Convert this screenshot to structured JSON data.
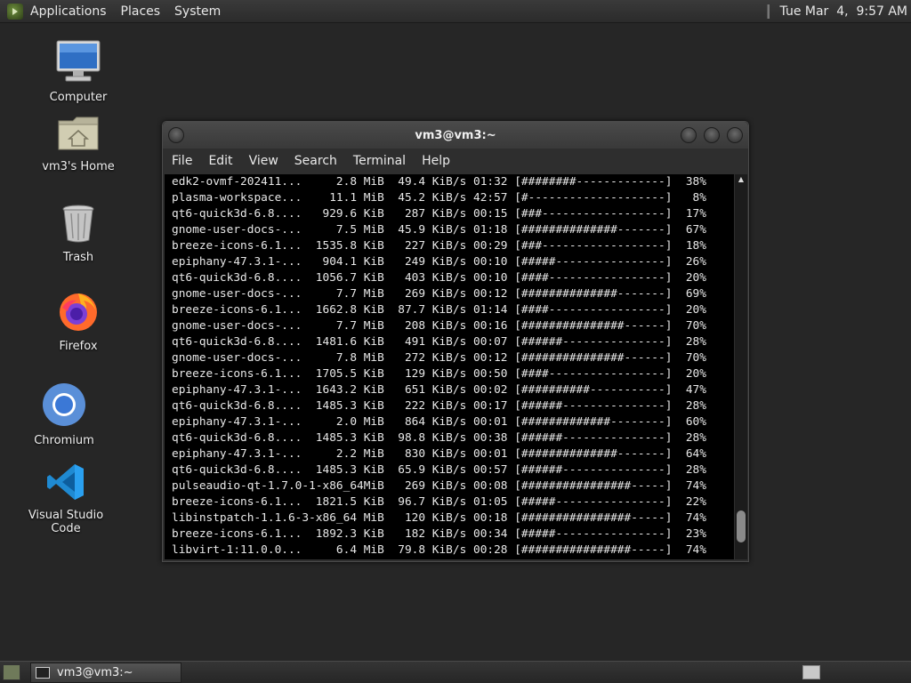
{
  "top_panel": {
    "menus": [
      "Applications",
      "Places",
      "System"
    ],
    "clock": "Tue Mar  4,  9:57 AM"
  },
  "desktop": {
    "icons": [
      {
        "label": "Computer",
        "icon": "computer-icon"
      },
      {
        "label": "vm3's Home",
        "icon": "home-folder-icon"
      },
      {
        "label": "Trash",
        "icon": "trash-icon"
      },
      {
        "label": "Firefox",
        "icon": "firefox-icon"
      },
      {
        "label": "Chromium",
        "icon": "chromium-icon"
      },
      {
        "label": "Visual Studio Code",
        "icon": "vscode-icon"
      }
    ]
  },
  "window": {
    "title": "vm3@vm3:~",
    "menu": [
      "File",
      "Edit",
      "View",
      "Search",
      "Terminal",
      "Help"
    ],
    "rows": [
      {
        "name": "edk2-ovmf-202411...",
        "size": "2.8 MiB",
        "rate": "49.4 KiB/s",
        "eta": "01:32",
        "bar": "[########-------------]",
        "pct": "38%"
      },
      {
        "name": "plasma-workspace...",
        "size": "11.1 MiB",
        "rate": "45.2 KiB/s",
        "eta": "42:57",
        "bar": "[#--------------------]",
        "pct": "8%"
      },
      {
        "name": "qt6-quick3d-6.8....",
        "size": "929.6 KiB",
        "rate": "287 KiB/s",
        "eta": "00:15",
        "bar": "[###------------------]",
        "pct": "17%"
      },
      {
        "name": "gnome-user-docs-...",
        "size": "7.5 MiB",
        "rate": "45.9 KiB/s",
        "eta": "01:18",
        "bar": "[##############-------]",
        "pct": "67%"
      },
      {
        "name": "breeze-icons-6.1...",
        "size": "1535.8 KiB",
        "rate": "227 KiB/s",
        "eta": "00:29",
        "bar": "[###------------------]",
        "pct": "18%"
      },
      {
        "name": "epiphany-47.3.1-...",
        "size": "904.1 KiB",
        "rate": "249 KiB/s",
        "eta": "00:10",
        "bar": "[#####----------------]",
        "pct": "26%"
      },
      {
        "name": "qt6-quick3d-6.8....",
        "size": "1056.7 KiB",
        "rate": "403 KiB/s",
        "eta": "00:10",
        "bar": "[####-----------------]",
        "pct": "20%"
      },
      {
        "name": "gnome-user-docs-...",
        "size": "7.7 MiB",
        "rate": "269 KiB/s",
        "eta": "00:12",
        "bar": "[##############-------]",
        "pct": "69%"
      },
      {
        "name": "breeze-icons-6.1...",
        "size": "1662.8 KiB",
        "rate": "87.7 KiB/s",
        "eta": "01:14",
        "bar": "[####-----------------]",
        "pct": "20%"
      },
      {
        "name": "gnome-user-docs-...",
        "size": "7.7 MiB",
        "rate": "208 KiB/s",
        "eta": "00:16",
        "bar": "[###############------]",
        "pct": "70%"
      },
      {
        "name": "qt6-quick3d-6.8....",
        "size": "1481.6 KiB",
        "rate": "491 KiB/s",
        "eta": "00:07",
        "bar": "[######---------------]",
        "pct": "28%"
      },
      {
        "name": "gnome-user-docs-...",
        "size": "7.8 MiB",
        "rate": "272 KiB/s",
        "eta": "00:12",
        "bar": "[###############------]",
        "pct": "70%"
      },
      {
        "name": "breeze-icons-6.1...",
        "size": "1705.5 KiB",
        "rate": "129 KiB/s",
        "eta": "00:50",
        "bar": "[####-----------------]",
        "pct": "20%"
      },
      {
        "name": "epiphany-47.3.1-...",
        "size": "1643.2 KiB",
        "rate": "651 KiB/s",
        "eta": "00:02",
        "bar": "[##########-----------]",
        "pct": "47%"
      },
      {
        "name": "qt6-quick3d-6.8....",
        "size": "1485.3 KiB",
        "rate": "222 KiB/s",
        "eta": "00:17",
        "bar": "[######---------------]",
        "pct": "28%"
      },
      {
        "name": "epiphany-47.3.1-...",
        "size": "2.0 MiB",
        "rate": "864 KiB/s",
        "eta": "00:01",
        "bar": "[#############--------]",
        "pct": "60%"
      },
      {
        "name": "qt6-quick3d-6.8....",
        "size": "1485.3 KiB",
        "rate": "98.8 KiB/s",
        "eta": "00:38",
        "bar": "[######---------------]",
        "pct": "28%"
      },
      {
        "name": "epiphany-47.3.1-...",
        "size": "2.2 MiB",
        "rate": "830 KiB/s",
        "eta": "00:01",
        "bar": "[##############-------]",
        "pct": "64%"
      },
      {
        "name": "qt6-quick3d-6.8....",
        "size": "1485.3 KiB",
        "rate": "65.9 KiB/s",
        "eta": "00:57",
        "bar": "[######---------------]",
        "pct": "28%"
      },
      {
        "name": "pulseaudio-qt-1.7.0-1-x86_64",
        "size": "MiB",
        "rate": "269 KiB/s",
        "eta": "00:08",
        "bar": "[################-----]",
        "pct": "74%"
      },
      {
        "name": "breeze-icons-6.1...",
        "size": "1821.5 KiB",
        "rate": "96.7 KiB/s",
        "eta": "01:05",
        "bar": "[#####----------------]",
        "pct": "22%"
      },
      {
        "name": "libinstpatch-1.1.6-3-x86_64",
        "size": "MiB",
        "rate": "120 KiB/s",
        "eta": "00:18",
        "bar": "[################-----]",
        "pct": "74%"
      },
      {
        "name": "breeze-icons-6.1...",
        "size": "1892.3 KiB",
        "rate": "182 KiB/s",
        "eta": "00:34",
        "bar": "[#####----------------]",
        "pct": "23%"
      },
      {
        "name": "libvirt-1:11.0.0...",
        "size": "6.4 MiB",
        "rate": "79.8 KiB/s",
        "eta": "00:28",
        "bar": "[################-----]",
        "pct": "74%"
      }
    ]
  },
  "taskbar": {
    "task_label": "vm3@vm3:~"
  }
}
